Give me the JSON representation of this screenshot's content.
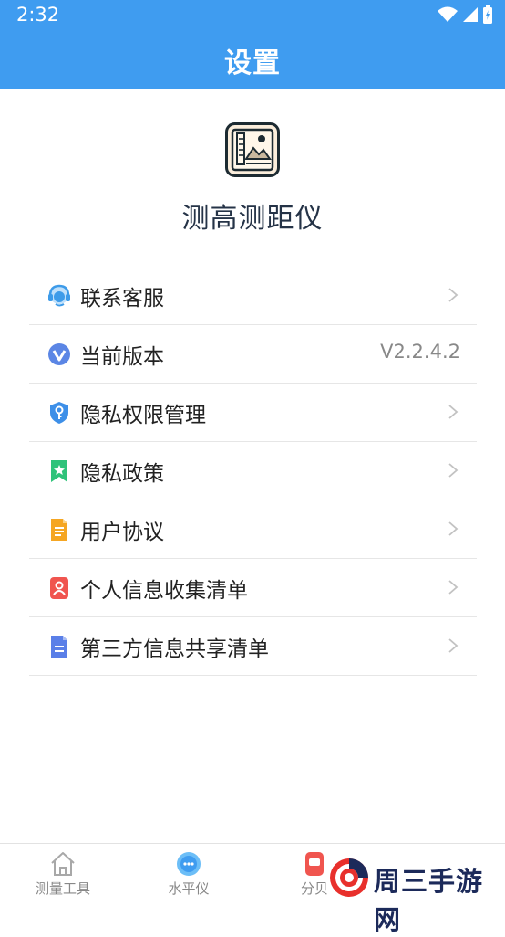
{
  "status_bar": {
    "time": "2:32"
  },
  "header": {
    "title": "设置"
  },
  "app": {
    "name": "测高测距仪"
  },
  "menu": [
    {
      "label": "联系客服",
      "icon": "customer-service-icon",
      "color": "#3d9be9"
    },
    {
      "label": "当前版本",
      "icon": "version-icon",
      "color": "#5b86e5",
      "value": "V2.2.4.2"
    },
    {
      "label": "隐私权限管理",
      "icon": "shield-key-icon",
      "color": "#3d8fe8"
    },
    {
      "label": "隐私政策",
      "icon": "bookmark-star-icon",
      "color": "#2fc37a"
    },
    {
      "label": "用户协议",
      "icon": "document-icon",
      "color": "#f5a623"
    },
    {
      "label": "个人信息收集清单",
      "icon": "person-card-icon",
      "color": "#f0554f"
    },
    {
      "label": "第三方信息共享清单",
      "icon": "file-share-icon",
      "color": "#5a7fe8"
    }
  ],
  "tabs": [
    {
      "label": "测量工具",
      "icon": "home-icon"
    },
    {
      "label": "水平仪",
      "icon": "level-icon"
    },
    {
      "label": "分贝",
      "icon": "decibel-icon"
    }
  ],
  "watermark": {
    "text": "周三手游网"
  },
  "colors": {
    "primary": "#3f9cf0"
  }
}
